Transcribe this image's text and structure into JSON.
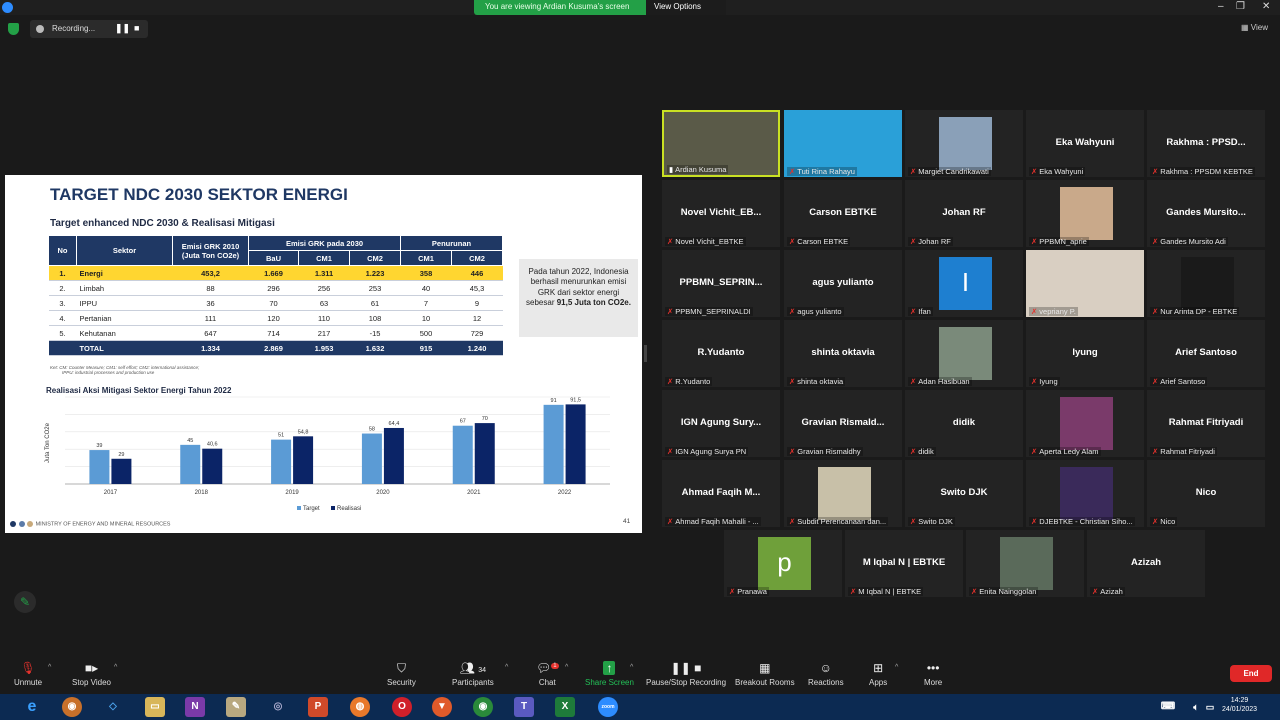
{
  "window": {
    "banner_text": "You are viewing Ardian Kusuma's screen",
    "view_options": "View Options",
    "recording": "Recording...",
    "view": "View"
  },
  "slide": {
    "title": "TARGET NDC 2030 SEKTOR ENERGI",
    "subtitle": "Target enhanced NDC 2030 & Realisasi Mitigasi",
    "table": {
      "h_no": "No",
      "h_sektor": "Sektor",
      "h_emisi2010": "Emisi GRK 2010 (Juta Ton CO2e)",
      "h_emisi2030": "Emisi GRK pada 2030",
      "h_penurunan": "Penurunan",
      "h_bau": "BaU",
      "h_cm1": "CM1",
      "h_cm2": "CM2",
      "h_cm1b": "CM1",
      "h_cm2b": "CM2",
      "rows": [
        {
          "no": "1.",
          "sektor": "Energi",
          "e2010": "453,2",
          "bau": "1.669",
          "cm1": "1.311",
          "cm2": "1.223",
          "p1": "358",
          "p2": "446"
        },
        {
          "no": "2.",
          "sektor": "Limbah",
          "e2010": "88",
          "bau": "296",
          "cm1": "256",
          "cm2": "253",
          "p1": "40",
          "p2": "45,3"
        },
        {
          "no": "3.",
          "sektor": "IPPU",
          "e2010": "36",
          "bau": "70",
          "cm1": "63",
          "cm2": "61",
          "p1": "7",
          "p2": "9"
        },
        {
          "no": "4.",
          "sektor": "Pertanian",
          "e2010": "111",
          "bau": "120",
          "cm1": "110",
          "cm2": "108",
          "p1": "10",
          "p2": "12"
        },
        {
          "no": "5.",
          "sektor": "Kehutanan",
          "e2010": "647",
          "bau": "714",
          "cm1": "217",
          "cm2": "-15",
          "p1": "500",
          "p2": "729"
        }
      ],
      "total": {
        "label": "TOTAL",
        "e2010": "1.334",
        "bau": "2.869",
        "cm1": "1.953",
        "cm2": "1.632",
        "p1": "915",
        "p2": "1.240"
      }
    },
    "callout_pre": "Pada tahun 2022, Indonesia berhasil menurunkan emisi GRK dari sektor energi sebesar",
    "callout_bold": "91,5 Juta ton CO2e.",
    "footnote_1": "Ket: CM: Counter Measure; CM1: self effort; CM2: international assistance;",
    "footnote_2": "IPPU: industrial processes and production use",
    "chart_title": "Realisasi Aksi Mitigasi Sektor Energi Tahun 2022",
    "footer": "MINISTRY OF ENERGY AND MINERAL RESOURCES",
    "page_number": "41"
  },
  "chart_data": {
    "type": "bar",
    "title": "Realisasi Aksi Mitigasi Sektor Energi Tahun 2022",
    "ylabel": "Juta Ton CO2e",
    "categories": [
      "2017",
      "2018",
      "2019",
      "2020",
      "2021",
      "2022"
    ],
    "series": [
      {
        "name": "Target",
        "values": [
          39,
          45,
          51,
          58,
          67,
          91
        ],
        "labels": [
          "39",
          "45",
          "51",
          "58",
          "67",
          "91"
        ],
        "color": "#5b9bd5"
      },
      {
        "name": "Realisasi",
        "values": [
          29,
          40.6,
          54.8,
          64.4,
          70,
          91.5
        ],
        "labels": [
          "29",
          "40,6",
          "54,8",
          "64,4",
          "70",
          "91,5"
        ],
        "color": "#0b2467"
      }
    ],
    "ylim": [
      0,
      100
    ],
    "grid": true,
    "legend": "bottom"
  },
  "participants": [
    {
      "name": "Ardian Kusuma",
      "video": true,
      "vcolor": "#5a5a48",
      "active": true
    },
    {
      "name": "Tuti Rina Rahayu",
      "video": true,
      "vcolor": "#2aa0d8"
    },
    {
      "name": "Margiet Candrikawati",
      "video": true,
      "vcolor": "#8aa0b8"
    },
    {
      "name": "Eka Wahyuni",
      "display": "Eka Wahyuni"
    },
    {
      "name": "Rakhma : PPSDM KEBTKE",
      "display": "Rakhma : PPSD..."
    },
    {
      "name": "Novel Vichit_EBTKE",
      "display": "Novel Vichit_EB..."
    },
    {
      "name": "Carson EBTKE",
      "display": "Carson EBTKE"
    },
    {
      "name": "Johan RF",
      "display": "Johan RF"
    },
    {
      "name": "PPBMN_aprie",
      "video": true,
      "vcolor": "#c9a98a"
    },
    {
      "name": "Gandes Mursito Adi",
      "display": "Gandes Mursito..."
    },
    {
      "name": "PPBMN_SEPRINALDI",
      "display": "PPBMN_SEPRIN..."
    },
    {
      "name": "agus yulianto",
      "display": "agus yulianto"
    },
    {
      "name": "Ifan",
      "video": true,
      "vcolor": "#1e7fd0",
      "letter": "I"
    },
    {
      "name": "vepriany P.",
      "video": true,
      "vcolor": "#d9cfc2",
      "wide": true
    },
    {
      "name": "Nur Arinta DP - EBTKE",
      "video": true,
      "vcolor": "#1a1a1a"
    },
    {
      "name": "R.Yudanto",
      "display": "R.Yudanto"
    },
    {
      "name": "shinta oktavia",
      "display": "shinta oktavia"
    },
    {
      "name": "Adan Hasibuan",
      "video": true,
      "vcolor": "#7a8a7a"
    },
    {
      "name": "Iyung",
      "display": "Iyung"
    },
    {
      "name": "Arief Santoso",
      "display": "Arief Santoso"
    },
    {
      "name": "IGN Agung Surya PN",
      "display": "IGN Agung Sury..."
    },
    {
      "name": "Gravian Rismaldhy",
      "display": "Gravian Rismald..."
    },
    {
      "name": "didik",
      "display": "didik"
    },
    {
      "name": "Aperta Ledy Alam",
      "video": true,
      "vcolor": "#7a3a6a"
    },
    {
      "name": "Rahmat Fitriyadi",
      "display": "Rahmat Fitriyadi"
    },
    {
      "name": "Ahmad Faqih Mahalli - ...",
      "display": "Ahmad Faqih M..."
    },
    {
      "name": "Subdit Perencanaan dan...",
      "video": true,
      "vcolor": "#c8c0a8"
    },
    {
      "name": "Swito DJK",
      "display": "Swito DJK"
    },
    {
      "name": "DJEBTKE - Christian Siho...",
      "video": true,
      "vcolor": "#3a2a5a"
    },
    {
      "name": "Nico",
      "display": "Nico"
    },
    {
      "name": "Pranawa",
      "video": true,
      "vcolor": "#6fa03a",
      "letter": "p"
    },
    {
      "name": "M Iqbal N | EBTKE",
      "display": "M Iqbal N | EBTKE"
    },
    {
      "name": "Enita Nainggolan",
      "video": true,
      "vcolor": "#5a6a5a"
    },
    {
      "name": "Azizah",
      "display": "Azizah"
    }
  ],
  "toolbar": {
    "unmute": "Unmute",
    "stop_video": "Stop Video",
    "security": "Security",
    "participants": "Participants",
    "participants_count": "34",
    "chat": "Chat",
    "chat_badge": "1",
    "share": "Share Screen",
    "pause": "Pause/Stop Recording",
    "breakout": "Breakout Rooms",
    "reactions": "Reactions",
    "apps": "Apps",
    "more": "More",
    "end": "End"
  },
  "taskbar": {
    "time": "14:29",
    "date": "24/01/2023"
  }
}
